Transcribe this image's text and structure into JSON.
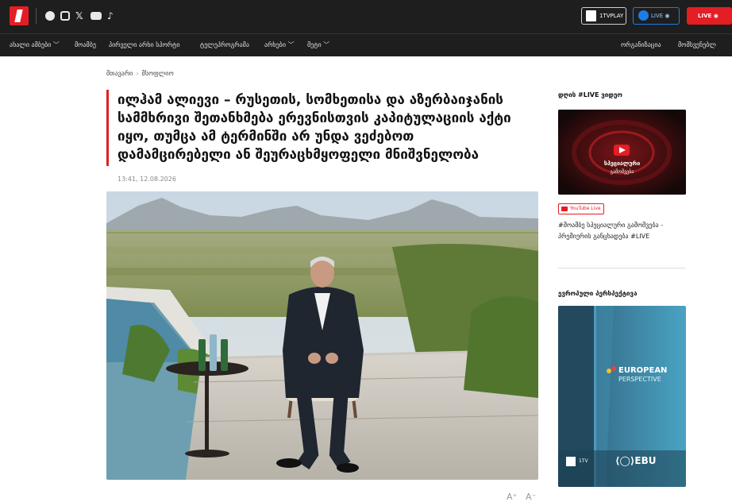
{
  "topbar": {
    "social_icons": [
      "facebook-icon",
      "instagram-icon",
      "x-icon",
      "youtube-icon",
      "tiktok-icon"
    ],
    "itvplay_label": "1TVPLAY",
    "live_blue_label": "LIVE",
    "live_red_label": "LIVE",
    "colors": {
      "brand": "#e31e24",
      "bar": "#1e1e1e",
      "live_blue": "#1a7ee6"
    }
  },
  "nav": {
    "items": [
      "ახალი ამბები ﹀",
      "მოამბე",
      "პირველი არხი სპორტი",
      "ტელეპროგრამა",
      "არხები ﹀",
      "მეტი ﹀"
    ],
    "right_items": [
      "ორგანიზაცია",
      "მომსვენებლ"
    ]
  },
  "breadcrumb": {
    "home": "მთავარი",
    "separator": "›",
    "current": "მსოფლიო"
  },
  "article": {
    "headline": "ილჰამ ალიევი – რუსეთის, სომხეთისა და აზერბაიჯანის სამმხრივი შეთანხმება ერევნისთვის კაპიტულაციის აქტი იყო, თუმცა ამ ტერმინში არ უნდა ვეძებოთ დამამცირებელი ან შეურაცხმყოფელი მნიშვნელობა",
    "timestamp": "13:41, 12.08.2026",
    "font_increase": "A⁺",
    "font_decrease": "A⁻"
  },
  "sidebar": {
    "video_heading": "დღის #LIVE ვიდეო",
    "video_overlay_line1": "სპეციალური",
    "video_overlay_line2": "გამოშვება",
    "youtube_badge": "YouTube Live",
    "video_caption": "#მოამბე სპეციალური გამოშვება - პრემიერის განცხადება #LIVE",
    "europe_heading": "ევროპული პერსპექტივა",
    "europe_brand": "EUROPEAN",
    "europe_brand_sub": "PERSPECTIVE",
    "partner_1tv": "1TV",
    "partner_ebu": "EBU"
  }
}
